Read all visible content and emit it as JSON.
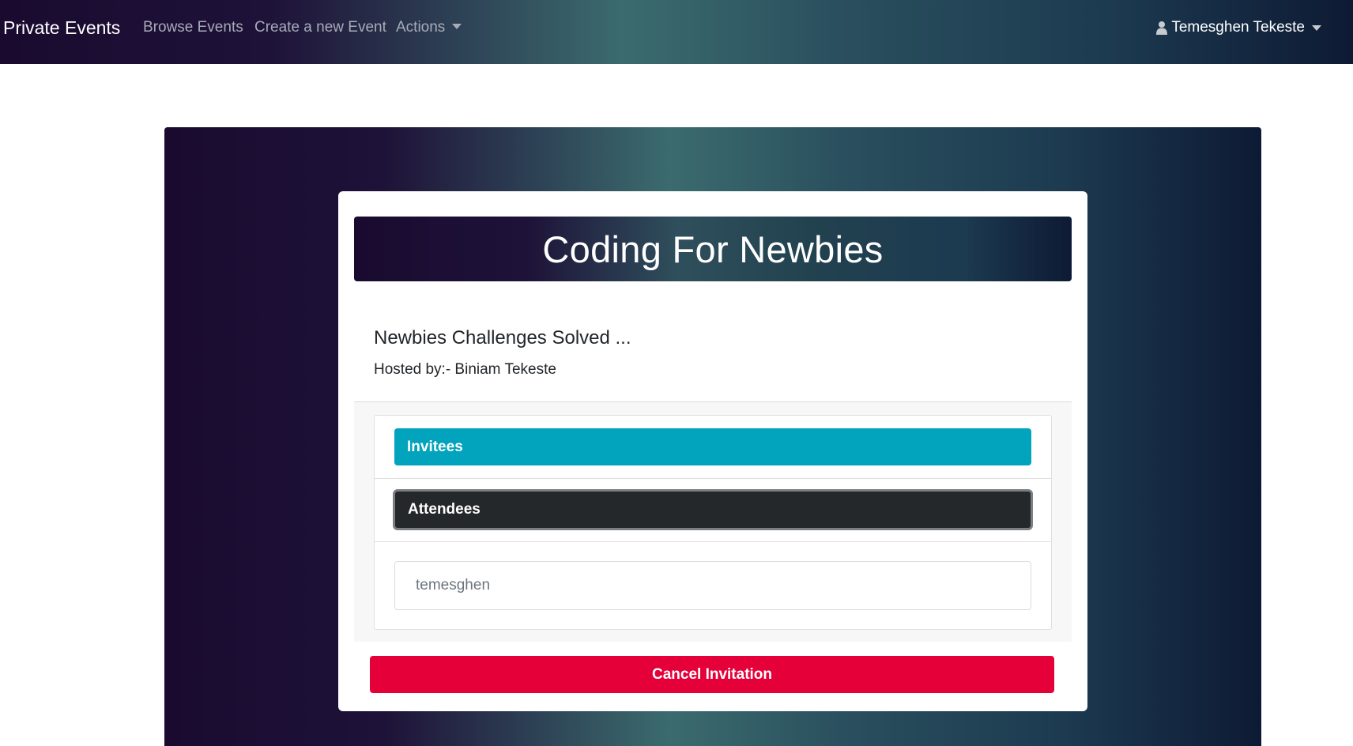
{
  "navbar": {
    "brand": "Private Events",
    "links": [
      "Browse Events",
      "Create a new Event",
      "Actions"
    ],
    "user_name": "Temesghen Tekeste"
  },
  "event": {
    "title": "Coding For Newbies",
    "description": "Newbies Challenges Solved ...",
    "host_line": "Hosted by:- Biniam Tekeste"
  },
  "panel": {
    "invitees_label": "Invitees",
    "attendees_label": "Attendees",
    "attendees": [
      "temesghen"
    ]
  },
  "actions": {
    "cancel_label": "Cancel Invitation"
  },
  "colors": {
    "invitees_button": "#02a3bc",
    "attendees_button": "#25282b",
    "cancel_button": "#e5003a"
  }
}
